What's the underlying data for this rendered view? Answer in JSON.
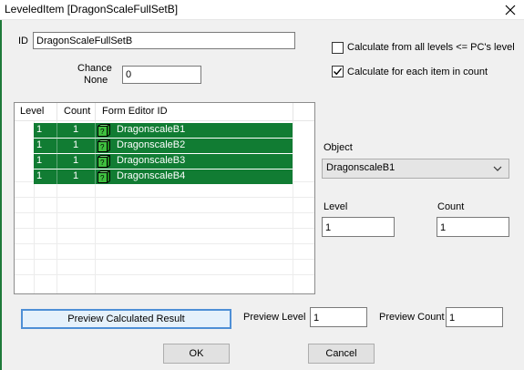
{
  "window": {
    "title": "LeveledItem [DragonScaleFullSetB]"
  },
  "id_field": {
    "label": "ID",
    "value": "DragonScaleFullSetB"
  },
  "chance_none": {
    "label_line1": "Chance",
    "label_line2": "None",
    "value": "0"
  },
  "options": {
    "calc_all_levels": {
      "label": "Calculate from all levels <= PC's level",
      "checked": false
    },
    "calc_each_item": {
      "label": "Calculate for each item in count",
      "checked": true
    }
  },
  "list": {
    "columns": [
      "Level",
      "Count",
      "Form Editor ID"
    ],
    "rows": [
      {
        "level": "1",
        "count": "1",
        "icon": "armor-item-icon",
        "editor_id": "DragonscaleB1"
      },
      {
        "level": "1",
        "count": "1",
        "icon": "armor-item-icon",
        "editor_id": "DragonscaleB2"
      },
      {
        "level": "1",
        "count": "1",
        "icon": "armor-item-icon",
        "editor_id": "DragonscaleB3"
      },
      {
        "level": "1",
        "count": "1",
        "icon": "armor-item-icon",
        "editor_id": "DragonscaleB4"
      }
    ],
    "row_color": "#117c33"
  },
  "object": {
    "label": "Object",
    "selected": "DragonscaleB1"
  },
  "level_field": {
    "label": "Level",
    "value": "1"
  },
  "count_field": {
    "label": "Count",
    "value": "1"
  },
  "preview": {
    "button_label": "Preview Calculated Result",
    "level_label": "Preview Level",
    "level_value": "1",
    "count_label": "Preview Count",
    "count_value": "1"
  },
  "buttons": {
    "ok": "OK",
    "cancel": "Cancel"
  }
}
